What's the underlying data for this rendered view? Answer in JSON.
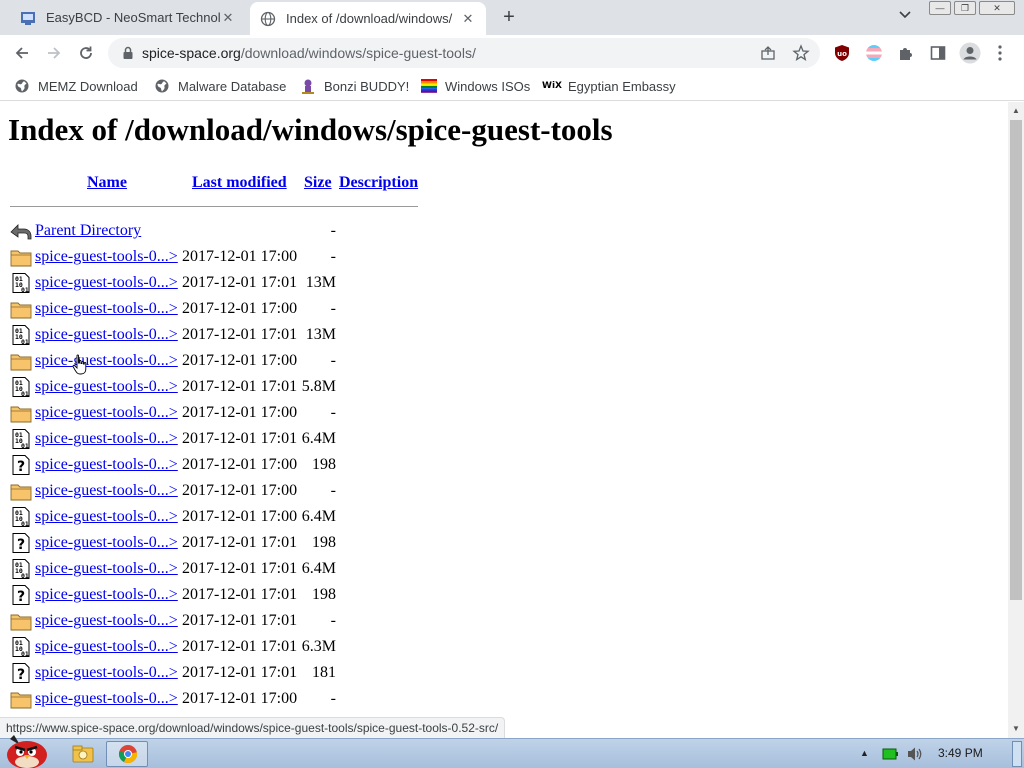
{
  "browser": {
    "tabs": [
      {
        "title": "EasyBCD - NeoSmart Technolo",
        "favicon": "easybcd-icon",
        "active": false
      },
      {
        "title": "Index of /download/windows/",
        "favicon": "globe-icon",
        "active": true
      }
    ],
    "address": {
      "host": "spice-space.org",
      "path": "/download/windows/spice-guest-tools/"
    },
    "bookmarks": [
      {
        "label": "MEMZ Download",
        "icon": "globe-icon"
      },
      {
        "label": "Malware Database",
        "icon": "globe-icon"
      },
      {
        "label": "Bonzi BUDDY!",
        "icon": "bonzi-icon"
      },
      {
        "label": "Windows ISOs",
        "icon": "rainbow-flag-icon"
      },
      {
        "label": "Egyptian Embassy",
        "icon": "wix-icon",
        "icon_text": "WiX"
      }
    ]
  },
  "page": {
    "heading": "Index of /download/windows/spice-guest-tools",
    "columns": {
      "name": "Name",
      "modified": "Last modified",
      "size": "Size",
      "description": "Description"
    },
    "parent": {
      "name": "Parent Directory",
      "size": "-"
    },
    "rows": [
      {
        "icon": "folder",
        "name": "spice-guest-tools-0...>",
        "modified": "2017-12-01 17:00",
        "size": "-"
      },
      {
        "icon": "binary",
        "name": "spice-guest-tools-0...>",
        "modified": "2017-12-01 17:01",
        "size": "13M"
      },
      {
        "icon": "folder",
        "name": "spice-guest-tools-0...>",
        "modified": "2017-12-01 17:00",
        "size": "-"
      },
      {
        "icon": "binary",
        "name": "spice-guest-tools-0...>",
        "modified": "2017-12-01 17:01",
        "size": "13M"
      },
      {
        "icon": "folder",
        "name": "spice-guest-tools-0...>",
        "modified": "2017-12-01 17:00",
        "size": "-"
      },
      {
        "icon": "binary",
        "name": "spice-guest-tools-0...>",
        "modified": "2017-12-01 17:01",
        "size": "5.8M"
      },
      {
        "icon": "folder",
        "name": "spice-guest-tools-0...>",
        "modified": "2017-12-01 17:00",
        "size": "-"
      },
      {
        "icon": "binary",
        "name": "spice-guest-tools-0...>",
        "modified": "2017-12-01 17:01",
        "size": "6.4M"
      },
      {
        "icon": "unknown",
        "name": "spice-guest-tools-0...>",
        "modified": "2017-12-01 17:00",
        "size": "198"
      },
      {
        "icon": "folder",
        "name": "spice-guest-tools-0...>",
        "modified": "2017-12-01 17:00",
        "size": "-"
      },
      {
        "icon": "binary",
        "name": "spice-guest-tools-0...>",
        "modified": "2017-12-01 17:00",
        "size": "6.4M"
      },
      {
        "icon": "unknown",
        "name": "spice-guest-tools-0...>",
        "modified": "2017-12-01 17:01",
        "size": "198"
      },
      {
        "icon": "binary",
        "name": "spice-guest-tools-0...>",
        "modified": "2017-12-01 17:01",
        "size": "6.4M"
      },
      {
        "icon": "unknown",
        "name": "spice-guest-tools-0...>",
        "modified": "2017-12-01 17:01",
        "size": "198"
      },
      {
        "icon": "folder",
        "name": "spice-guest-tools-0...>",
        "modified": "2017-12-01 17:01",
        "size": "-"
      },
      {
        "icon": "binary",
        "name": "spice-guest-tools-0...>",
        "modified": "2017-12-01 17:01",
        "size": "6.3M"
      },
      {
        "icon": "unknown",
        "name": "spice-guest-tools-0...>",
        "modified": "2017-12-01 17:01",
        "size": "181"
      },
      {
        "icon": "folder",
        "name": "spice-guest-tools-0...>",
        "modified": "2017-12-01 17:00",
        "size": "-"
      }
    ],
    "status_url": "https://www.spice-space.org/download/windows/spice-guest-tools/spice-guest-tools-0.52-src/"
  },
  "taskbar": {
    "clock": "3:49 PM",
    "items": [
      "angry-bird-start-icon",
      "explorer-folder-icon",
      "chrome-icon"
    ]
  },
  "colors": {
    "link": "#0000ee",
    "tab_strip": "#dee1e6",
    "omnibox": "#f1f3f4",
    "taskbar": "#a7bfdc"
  }
}
